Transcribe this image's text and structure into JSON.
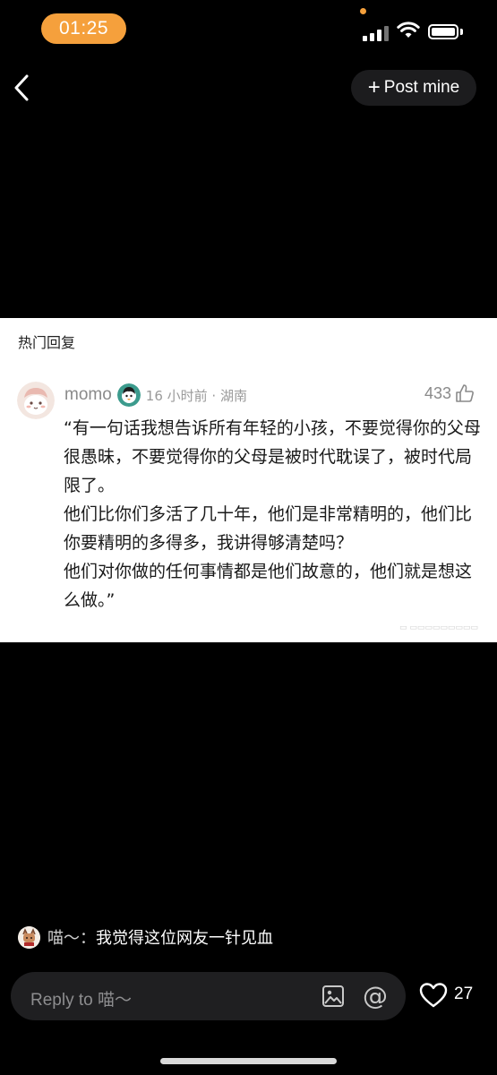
{
  "status_bar": {
    "time": "01:25"
  },
  "header": {
    "post_button_label": "Post mine"
  },
  "image_card": {
    "section_title": "热门回复",
    "comment": {
      "username": "momo",
      "meta": "16 小时前 · 湖南",
      "like_count": "433",
      "text": "“有一句话我想告诉所有年轻的小孩，不要觉得你的父母很愚昧，不要觉得你的父母是被时代耽误了，被时代局限了。\n他们比你们多活了几十年，他们是非常精明的，他们比你要精明的多得多，我讲得够清楚吗？\n他们对你做的任何事情都是他们故意的，他们就是想这么做。”"
    }
  },
  "caption": {
    "author": "喵～：",
    "text": "我觉得这位网友一针见血"
  },
  "reply": {
    "placeholder": "Reply to 喵～",
    "like_count": "27"
  },
  "colors": {
    "accent": "#f5a03c",
    "background": "#000000",
    "reply_bar": "#1f1f21"
  }
}
